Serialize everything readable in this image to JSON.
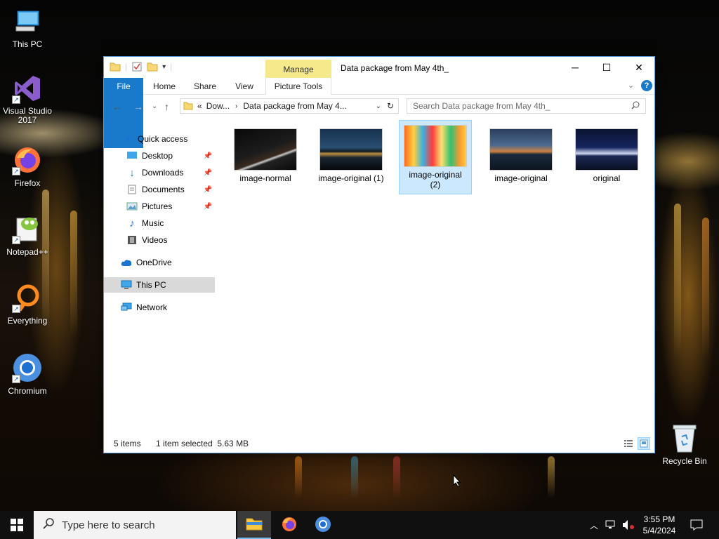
{
  "desktop": {
    "icons": [
      {
        "label": "This PC"
      },
      {
        "label": "Visual Studio 2017"
      },
      {
        "label": "Firefox"
      },
      {
        "label": "Notepad++"
      },
      {
        "label": "Everything"
      },
      {
        "label": "Chromium"
      },
      {
        "label": "Recycle Bin"
      }
    ]
  },
  "window": {
    "title": "Data package from May 4th_",
    "manage_tab": "Manage",
    "picture_tools": "Picture Tools",
    "ribbon_tabs": [
      "File",
      "Home",
      "Share",
      "View"
    ],
    "address": {
      "prefix": "«",
      "crumb1": "Dow...",
      "crumb2": "Data package from May 4..."
    },
    "search_placeholder": "Search Data package from May 4th_",
    "nav": [
      {
        "label": "Quick access"
      },
      {
        "label": "Desktop"
      },
      {
        "label": "Downloads"
      },
      {
        "label": "Documents"
      },
      {
        "label": "Pictures"
      },
      {
        "label": "Music"
      },
      {
        "label": "Videos"
      },
      {
        "label": "OneDrive"
      },
      {
        "label": "This PC"
      },
      {
        "label": "Network"
      }
    ],
    "files": [
      {
        "name": "image-normal"
      },
      {
        "name": "image-original (1)"
      },
      {
        "name": "image-original (2)"
      },
      {
        "name": "image-original"
      },
      {
        "name": "original"
      }
    ],
    "status": {
      "count": "5 items",
      "selection": "1 item selected  5.63 MB"
    }
  },
  "taskbar": {
    "search_placeholder": "Type here to search",
    "time": "3:55 PM",
    "date": "5/4/2024"
  }
}
